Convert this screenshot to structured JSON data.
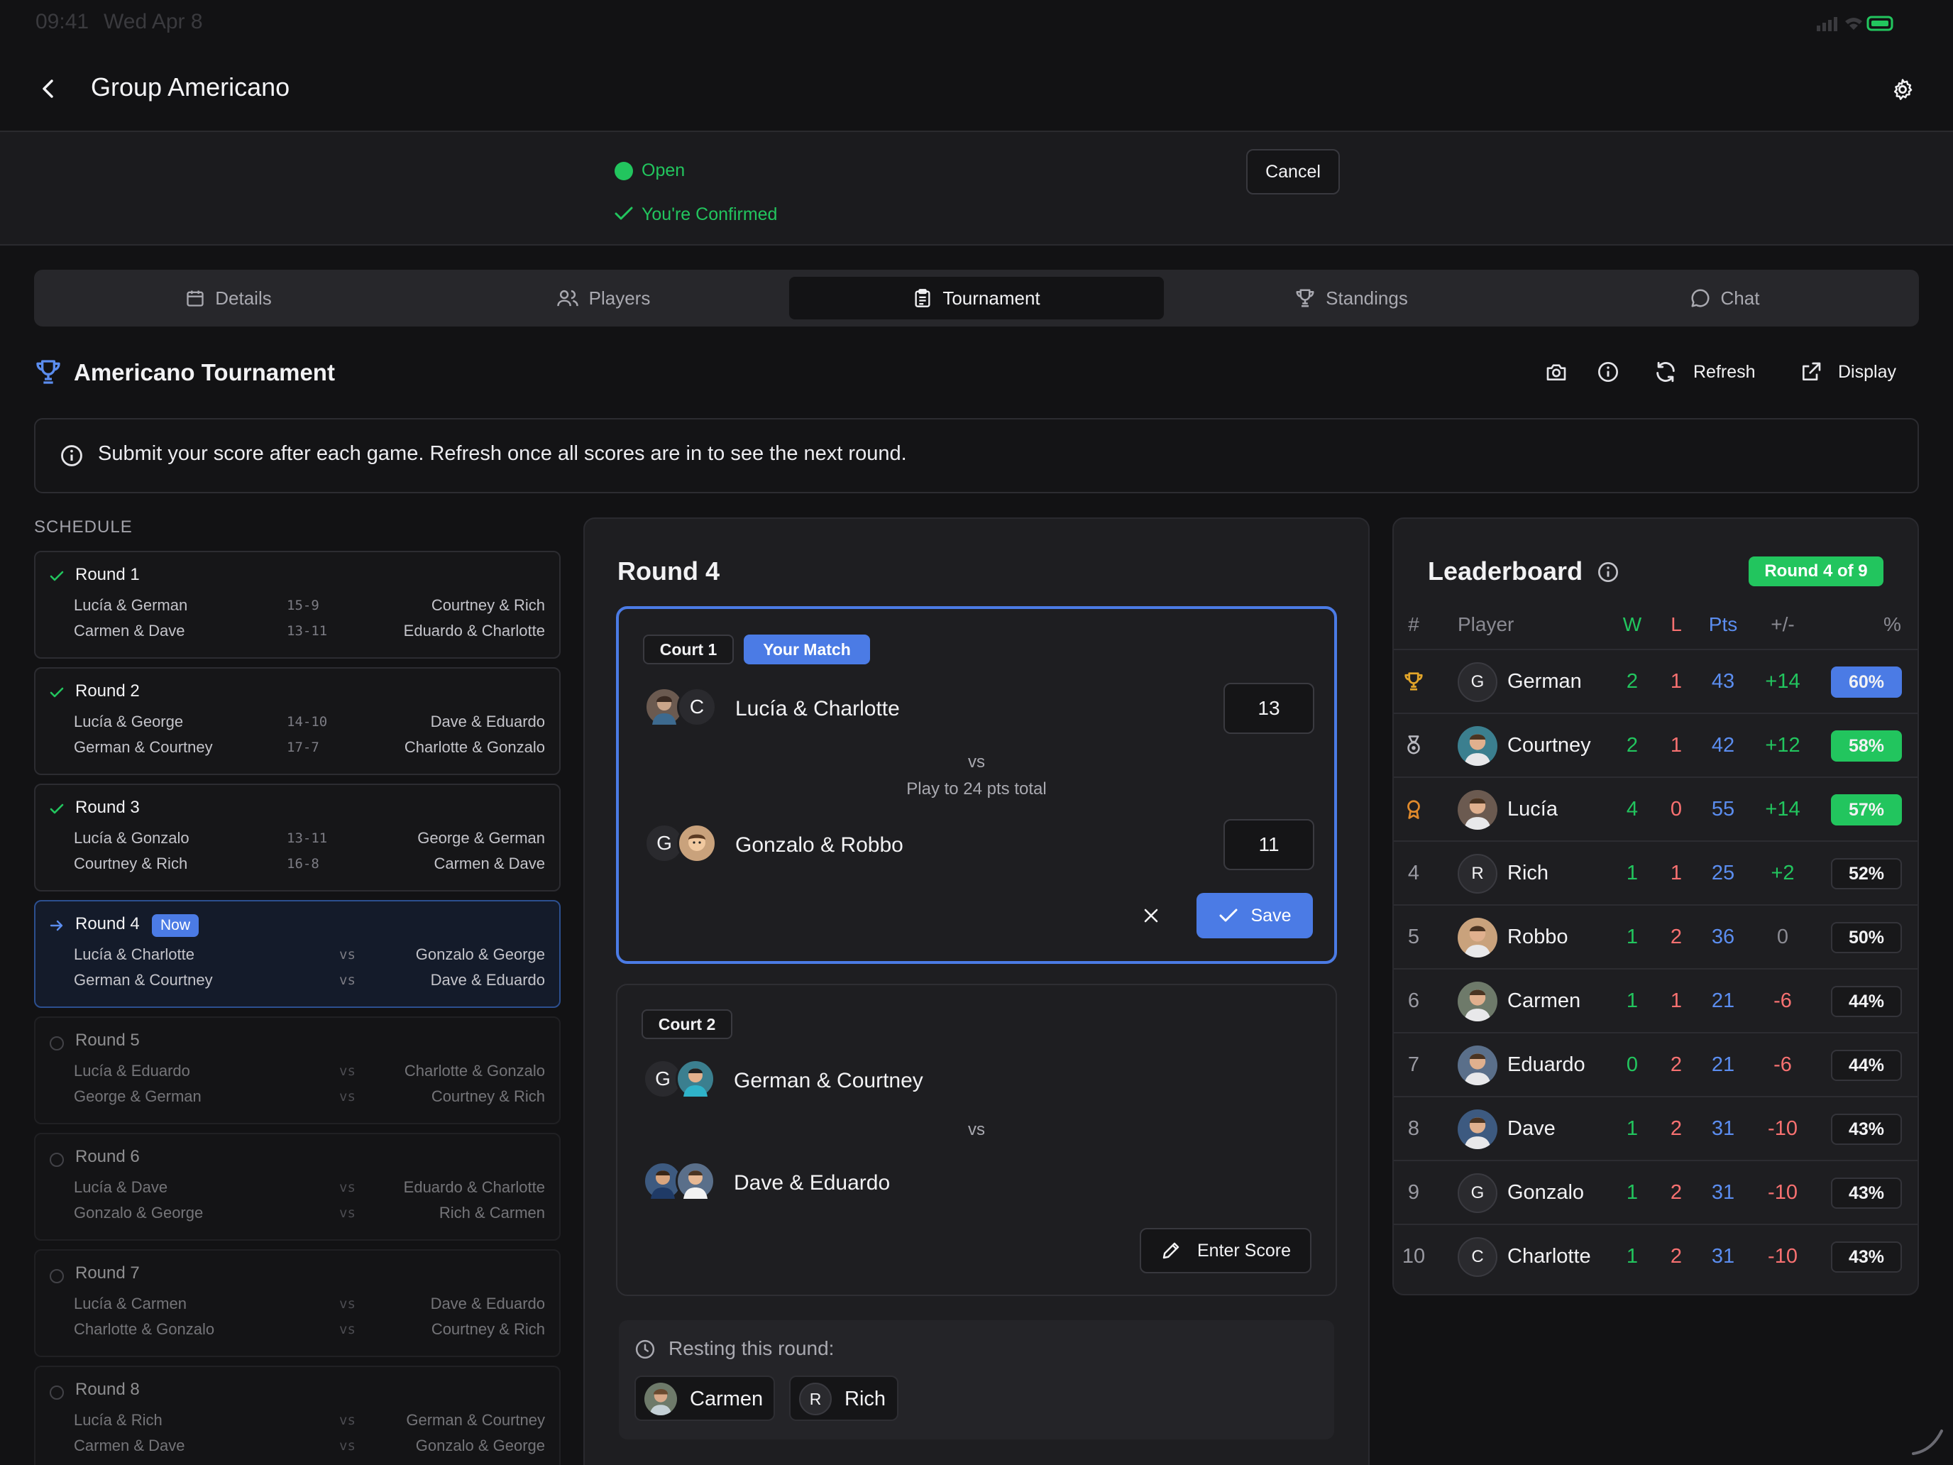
{
  "status_bar": {
    "time": "09:41",
    "date": "Wed Apr 8"
  },
  "header": {
    "title": "Group Americano"
  },
  "banner": {
    "status": "Open",
    "confirmation": "You're Confirmed",
    "cancel_label": "Cancel"
  },
  "tabs": [
    {
      "label": "Details",
      "icon": "calendar-icon"
    },
    {
      "label": "Players",
      "icon": "users-icon"
    },
    {
      "label": "Tournament",
      "icon": "clipboard-icon",
      "active": true
    },
    {
      "label": "Standings",
      "icon": "trophy-icon"
    },
    {
      "label": "Chat",
      "icon": "chat-icon"
    }
  ],
  "section": {
    "title": "Americano Tournament",
    "refresh_label": "Refresh",
    "display_label": "Display"
  },
  "info": {
    "text": "Submit your score after each game. Refresh once all scores are in to see the next round."
  },
  "schedule": {
    "heading": "SCHEDULE",
    "now_badge": "Now",
    "rounds": [
      {
        "title": "Round 1",
        "state": "done",
        "matches": [
          {
            "a": "Lucía & German",
            "score": "15-9",
            "b": "Courtney & Rich"
          },
          {
            "a": "Carmen & Dave",
            "score": "13-11",
            "b": "Eduardo & Charlotte"
          }
        ]
      },
      {
        "title": "Round 2",
        "state": "done",
        "matches": [
          {
            "a": "Lucía & George",
            "score": "14-10",
            "b": "Dave & Eduardo"
          },
          {
            "a": "German & Courtney",
            "score": "17-7",
            "b": "Charlotte & Gonzalo"
          }
        ]
      },
      {
        "title": "Round 3",
        "state": "done",
        "matches": [
          {
            "a": "Lucía & Gonzalo",
            "score": "13-11",
            "b": "George & German"
          },
          {
            "a": "Courtney & Rich",
            "score": "16-8",
            "b": "Carmen & Dave"
          }
        ]
      },
      {
        "title": "Round 4",
        "state": "now",
        "matches": [
          {
            "a": "Lucía & Charlotte",
            "score": "vs",
            "b": "Gonzalo & George"
          },
          {
            "a": "German & Courtney",
            "score": "vs",
            "b": "Dave & Eduardo"
          }
        ]
      },
      {
        "title": "Round 5",
        "state": "future",
        "matches": [
          {
            "a": "Lucía & Eduardo",
            "score": "vs",
            "b": "Charlotte & Gonzalo"
          },
          {
            "a": "George & German",
            "score": "vs",
            "b": "Courtney & Rich"
          }
        ]
      },
      {
        "title": "Round 6",
        "state": "future",
        "matches": [
          {
            "a": "Lucía & Dave",
            "score": "vs",
            "b": "Eduardo & Charlotte"
          },
          {
            "a": "Gonzalo & George",
            "score": "vs",
            "b": "Rich & Carmen"
          }
        ]
      },
      {
        "title": "Round 7",
        "state": "future",
        "matches": [
          {
            "a": "Lucía & Carmen",
            "score": "vs",
            "b": "Dave & Eduardo"
          },
          {
            "a": "Charlotte & Gonzalo",
            "score": "vs",
            "b": "Courtney & Rich"
          }
        ]
      },
      {
        "title": "Round 8",
        "state": "future",
        "matches": [
          {
            "a": "Lucía & Rich",
            "score": "vs",
            "b": "German & Courtney"
          },
          {
            "a": "Carmen & Dave",
            "score": "vs",
            "b": "Gonzalo & George"
          }
        ]
      }
    ]
  },
  "round": {
    "title": "Round 4",
    "court1": {
      "label": "Court 1",
      "badge": "Your Match",
      "team_a": "Lucía & Charlotte",
      "score_a": "13",
      "vs": "vs",
      "rule": "Play to 24 pts total",
      "team_b": "Gonzalo & Robbo",
      "score_b": "11",
      "save_label": "Save",
      "team_a_initial": "C",
      "team_b_initial": "G"
    },
    "court2": {
      "label": "Court 2",
      "team_a": "German & Courtney",
      "vs": "vs",
      "team_b": "Dave & Eduardo",
      "enter_label": "Enter Score",
      "team_a_initial": "G"
    },
    "resting": {
      "label": "Resting this round:",
      "players": [
        "Carmen",
        "Rich"
      ],
      "rich_initial": "R"
    }
  },
  "leaderboard": {
    "title": "Leaderboard",
    "badge": "Round 4 of 9",
    "headers": {
      "rank": "#",
      "player": "Player",
      "w": "W",
      "l": "L",
      "pts": "Pts",
      "diff": "+/-",
      "pct": "%"
    },
    "rows": [
      {
        "rank": "1",
        "rank_icon": "trophy-icon",
        "avatar": "G",
        "name": "German",
        "w": "2",
        "l": "1",
        "pts": "43",
        "diff": "+14",
        "pct": "60%",
        "pct_style": "blue"
      },
      {
        "rank": "2",
        "rank_icon": "medal-icon",
        "avatar": "",
        "name": "Courtney",
        "w": "2",
        "l": "1",
        "pts": "42",
        "diff": "+12",
        "pct": "58%",
        "pct_style": "green"
      },
      {
        "rank": "3",
        "rank_icon": "award-icon",
        "avatar": "",
        "name": "Lucía",
        "w": "4",
        "l": "0",
        "pts": "55",
        "diff": "+14",
        "pct": "57%",
        "pct_style": "green"
      },
      {
        "rank": "4",
        "avatar": "R",
        "name": "Rich",
        "w": "1",
        "l": "1",
        "pts": "25",
        "diff": "+2",
        "pct": "52%",
        "pct_style": "plain"
      },
      {
        "rank": "5",
        "avatar": "",
        "name": "Robbo",
        "w": "1",
        "l": "2",
        "pts": "36",
        "diff": "0",
        "pct": "50%",
        "pct_style": "plain"
      },
      {
        "rank": "6",
        "avatar": "",
        "name": "Carmen",
        "w": "1",
        "l": "1",
        "pts": "21",
        "diff": "-6",
        "pct": "44%",
        "pct_style": "plain"
      },
      {
        "rank": "7",
        "avatar": "",
        "name": "Eduardo",
        "w": "0",
        "l": "2",
        "pts": "21",
        "diff": "-6",
        "pct": "44%",
        "pct_style": "plain"
      },
      {
        "rank": "8",
        "avatar": "",
        "name": "Dave",
        "w": "1",
        "l": "2",
        "pts": "31",
        "diff": "-10",
        "pct": "43%",
        "pct_style": "plain"
      },
      {
        "rank": "9",
        "avatar": "G",
        "name": "Gonzalo",
        "w": "1",
        "l": "2",
        "pts": "31",
        "diff": "-10",
        "pct": "43%",
        "pct_style": "plain"
      },
      {
        "rank": "10",
        "avatar": "C",
        "name": "Charlotte",
        "w": "1",
        "l": "2",
        "pts": "31",
        "diff": "-10",
        "pct": "43%",
        "pct_style": "plain"
      }
    ]
  },
  "colors": {
    "accent_blue": "#4b7be5",
    "accent_green": "#22c55e",
    "loss_red": "#f87171",
    "background": "#121214",
    "gold": "#e2a52a"
  }
}
